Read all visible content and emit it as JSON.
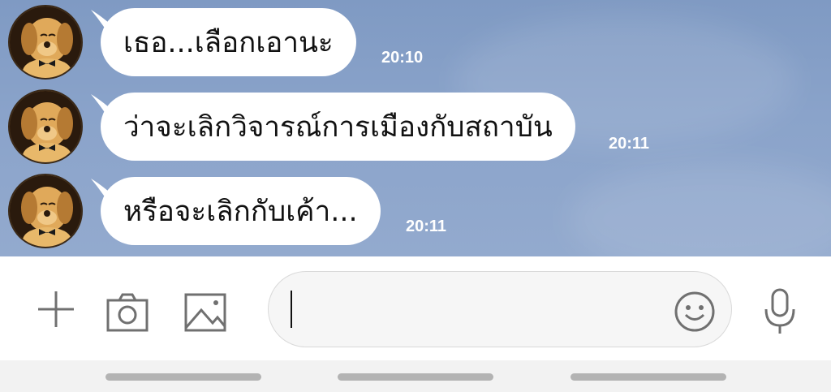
{
  "messages": [
    {
      "text": "เธอ...เลือกเอานะ",
      "time": "20:10"
    },
    {
      "text": "ว่าจะเลิกวิจารณ์การเมืองกับสถาบัน",
      "time": "20:11"
    },
    {
      "text": "หรือจะเลิกกับเค้า...",
      "time": "20:11"
    }
  ],
  "composer": {
    "placeholder": "",
    "icons": [
      "plus-icon",
      "camera-icon",
      "image-icon",
      "emoji-icon",
      "microphone-icon"
    ]
  },
  "colors": {
    "chat_background": "#8aa3ca",
    "bubble": "#ffffff",
    "timestamp": "#ffffff"
  }
}
